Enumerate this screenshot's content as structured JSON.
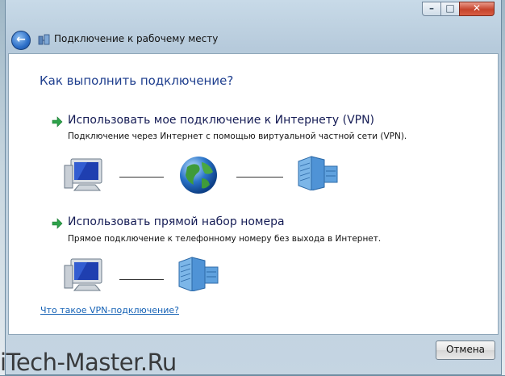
{
  "window": {
    "title": "Подключение к рабочему месту",
    "controls": {
      "minimize": "–",
      "maximize": "□",
      "close": "✕"
    }
  },
  "main": {
    "heading": "Как выполнить подключение?",
    "options": [
      {
        "title": "Использовать мое подключение к Интернету (VPN)",
        "description": "Подключение через Интернет с помощью виртуальной частной сети (VPN).",
        "diagram": [
          "computer-icon",
          "globe-icon",
          "server-icon"
        ]
      },
      {
        "title": "Использовать прямой набор номера",
        "description": "Прямое подключение к телефонному номеру без выхода в Интернет.",
        "diagram": [
          "computer-icon",
          "server-icon"
        ]
      }
    ],
    "help_link": "Что такое VPN-подключение?"
  },
  "footer": {
    "cancel_label": "Отмена"
  },
  "watermark": "iTech-Master.Ru",
  "colors": {
    "heading": "#1e3e8e",
    "link": "#1461b5",
    "arrow": "#2ea24a"
  }
}
